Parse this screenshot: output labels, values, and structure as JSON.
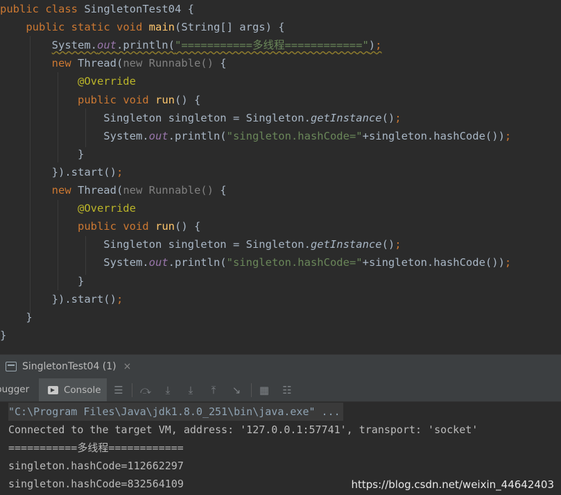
{
  "editor": {
    "lines": [
      [
        {
          "t": "public ",
          "c": "kw"
        },
        {
          "t": "class ",
          "c": "kw"
        },
        {
          "t": "SingletonTest04 {",
          "c": "plain"
        }
      ],
      [
        {
          "t": "    public ",
          "c": "kw"
        },
        {
          "t": "static ",
          "c": "kw"
        },
        {
          "t": "void ",
          "c": "kw"
        },
        {
          "t": "main",
          "c": "fn"
        },
        {
          "t": "(String[] args) {",
          "c": "plain"
        }
      ],
      [
        {
          "t": "        ",
          "c": "plain"
        },
        {
          "t": "System.",
          "c": "plain warn-underline"
        },
        {
          "t": "out",
          "c": "fld warn-underline"
        },
        {
          "t": ".println(",
          "c": "plain warn-underline"
        },
        {
          "t": "\"===========多线程============\"",
          "c": "str warn-underline"
        },
        {
          "t": ")",
          "c": "plain warn-underline"
        },
        {
          "t": ";",
          "c": "kw warn-underline"
        }
      ],
      [
        {
          "t": "        new ",
          "c": "kw"
        },
        {
          "t": "Thread(",
          "c": "plain"
        },
        {
          "t": "new ",
          "c": "dim"
        },
        {
          "t": "Runnable() ",
          "c": "dim"
        },
        {
          "t": "{",
          "c": "plain"
        }
      ],
      [
        {
          "t": "            @Override",
          "c": "ann"
        }
      ],
      [
        {
          "t": "            public ",
          "c": "kw"
        },
        {
          "t": "void ",
          "c": "kw"
        },
        {
          "t": "run",
          "c": "fn"
        },
        {
          "t": "() {",
          "c": "plain"
        }
      ],
      [
        {
          "t": "                Singleton singleton = Singleton.",
          "c": "plain"
        },
        {
          "t": "getInstance",
          "c": "plain itl"
        },
        {
          "t": "()",
          "c": "plain"
        },
        {
          "t": ";",
          "c": "kw"
        }
      ],
      [
        {
          "t": "                System.",
          "c": "plain"
        },
        {
          "t": "out",
          "c": "fld"
        },
        {
          "t": ".println(",
          "c": "plain"
        },
        {
          "t": "\"singleton.hashCode=\"",
          "c": "str"
        },
        {
          "t": "+singleton.hashCode())",
          "c": "plain"
        },
        {
          "t": ";",
          "c": "kw"
        }
      ],
      [
        {
          "t": "            }",
          "c": "plain"
        }
      ],
      [
        {
          "t": "        }).start()",
          "c": "plain"
        },
        {
          "t": ";",
          "c": "kw"
        }
      ],
      [
        {
          "t": "        new ",
          "c": "kw"
        },
        {
          "t": "Thread(",
          "c": "plain"
        },
        {
          "t": "new ",
          "c": "dim"
        },
        {
          "t": "Runnable() ",
          "c": "dim"
        },
        {
          "t": "{",
          "c": "plain"
        }
      ],
      [
        {
          "t": "            @Override",
          "c": "ann"
        }
      ],
      [
        {
          "t": "            public ",
          "c": "kw"
        },
        {
          "t": "void ",
          "c": "kw"
        },
        {
          "t": "run",
          "c": "fn"
        },
        {
          "t": "() {",
          "c": "plain"
        }
      ],
      [
        {
          "t": "                Singleton singleton = Singleton.",
          "c": "plain"
        },
        {
          "t": "getInstance",
          "c": "plain itl"
        },
        {
          "t": "()",
          "c": "plain"
        },
        {
          "t": ";",
          "c": "kw"
        }
      ],
      [
        {
          "t": "                System.",
          "c": "plain"
        },
        {
          "t": "out",
          "c": "fld"
        },
        {
          "t": ".println(",
          "c": "plain"
        },
        {
          "t": "\"singleton.hashCode=\"",
          "c": "str"
        },
        {
          "t": "+singleton.hashCode())",
          "c": "plain"
        },
        {
          "t": ";",
          "c": "kw"
        }
      ],
      [
        {
          "t": "            }",
          "c": "plain"
        }
      ],
      [
        {
          "t": "        }).start()",
          "c": "plain"
        },
        {
          "t": ";",
          "c": "kw"
        }
      ],
      [
        {
          "t": "    }",
          "c": "plain"
        }
      ],
      [
        {
          "t": "}",
          "c": "plain"
        }
      ]
    ]
  },
  "run_panel": {
    "tab_label": "SingletonTest04 (1)",
    "close_glyph": "×",
    "debugger_tab": "bugger",
    "console_tab": "Console"
  },
  "toolbar_icons": [
    "list-icon",
    "step-over-icon",
    "step-into-icon",
    "force-step-into-icon",
    "step-out-icon",
    "run-to-cursor-icon",
    "table-icon",
    "settings-sliders-icon"
  ],
  "console": {
    "lines": [
      "\"C:\\Program Files\\Java\\jdk1.8.0_251\\bin\\java.exe\" ...",
      "Connected to the target VM, address: '127.0.0.1:57741', transport: 'socket'",
      "===========多线程============",
      "singleton.hashCode=112662297",
      "singleton.hashCode=832564109"
    ]
  },
  "watermark": "https://blog.csdn.net/weixin_44642403"
}
